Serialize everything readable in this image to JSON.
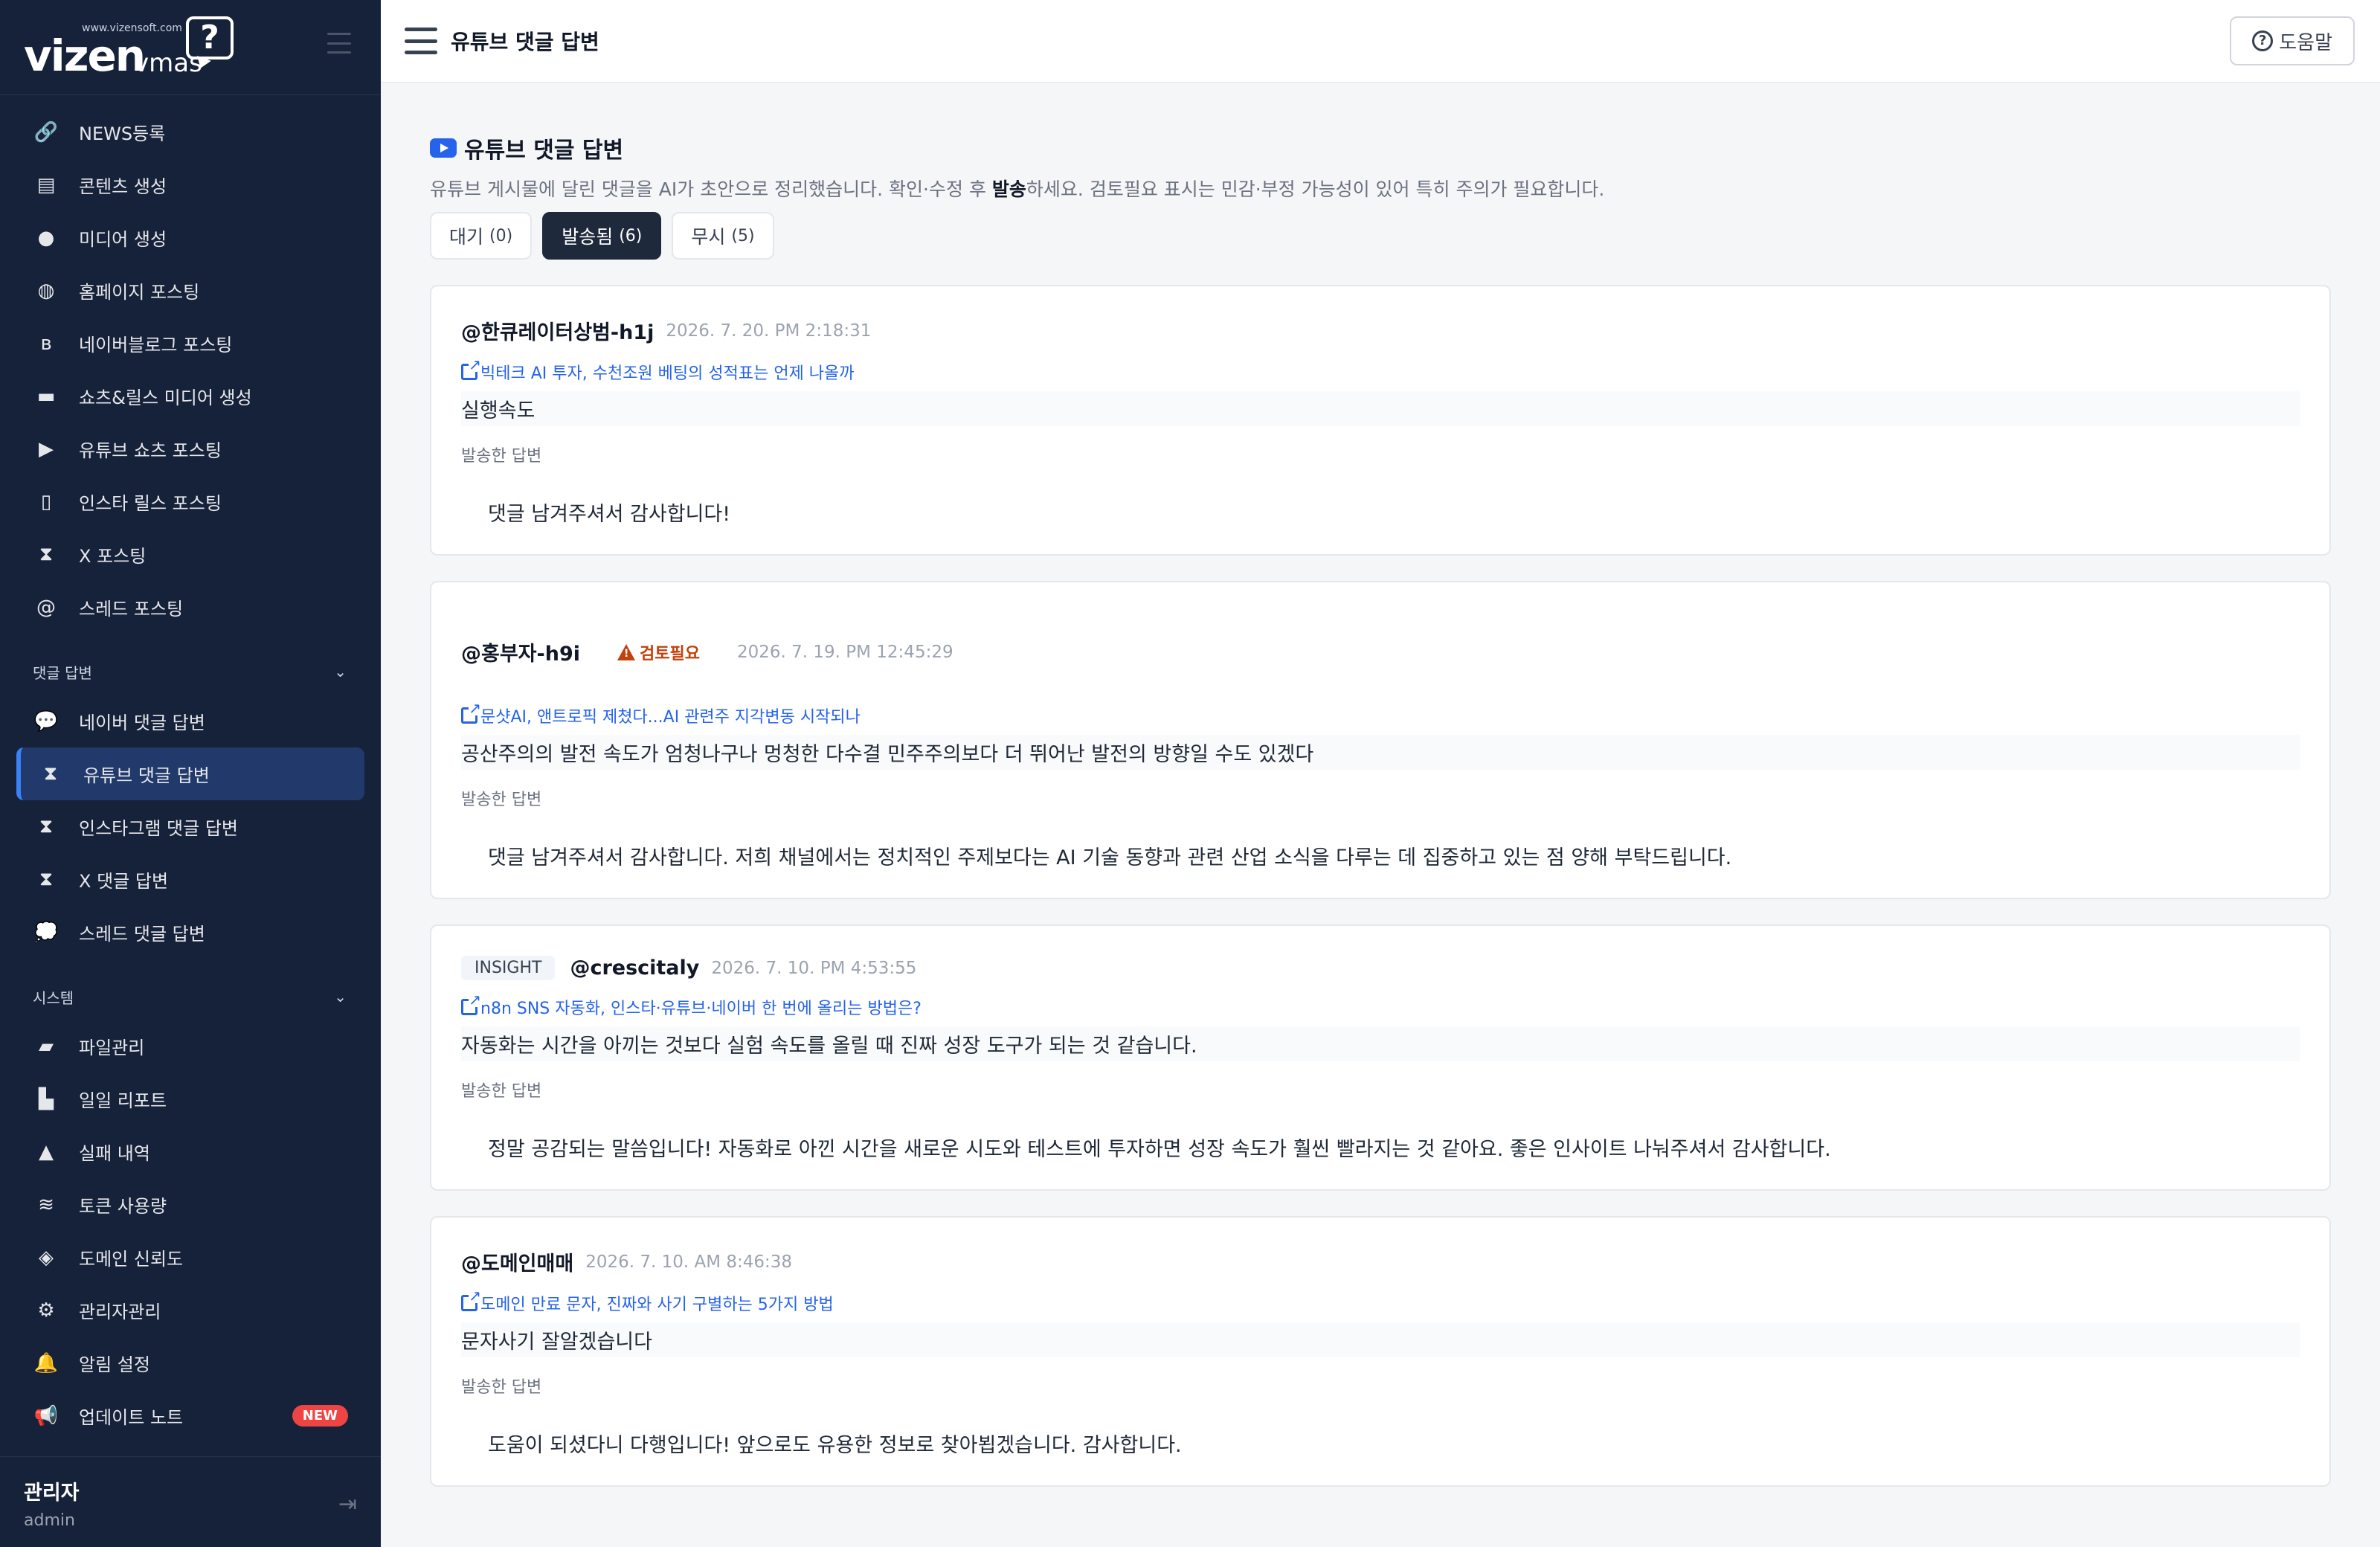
{
  "brand": {
    "logo_main": "vizen",
    "logo_sub": "vmas",
    "logo_url": "www.vizensoft.com",
    "logo_bubble": "?"
  },
  "nav": {
    "items": [
      {
        "label": "NEWS등록",
        "icon": "link-icon"
      },
      {
        "label": "콘텐츠 생성",
        "icon": "newspaper-icon"
      },
      {
        "label": "미디어 생성",
        "icon": "palette-icon"
      },
      {
        "label": "홈페이지 포스팅",
        "icon": "globe-icon"
      },
      {
        "label": "네이버블로그 포스팅",
        "icon": "blog-icon"
      },
      {
        "label": "쇼츠&릴스 미디어 생성",
        "icon": "clapperboard-icon"
      },
      {
        "label": "유튜브 쇼츠 포스팅",
        "icon": "play-icon"
      },
      {
        "label": "인스타 릴스 포스팅",
        "icon": "mobile-icon"
      },
      {
        "label": "X 포스팅",
        "icon": "hourglass-icon"
      },
      {
        "label": "스레드 포스팅",
        "icon": "at-icon"
      }
    ],
    "comment_section": "댓글 답변",
    "comment_items": [
      {
        "label": "네이버 댓글 답변",
        "icon": "comment-icon"
      },
      {
        "label": "유튜브 댓글 답변",
        "icon": "hourglass-icon"
      },
      {
        "label": "인스타그램 댓글 답변",
        "icon": "hourglass-icon"
      },
      {
        "label": "X 댓글 답변",
        "icon": "hourglass-icon"
      },
      {
        "label": "스레드 댓글 답변",
        "icon": "comments-icon"
      }
    ],
    "system_section": "시스템",
    "system_items": [
      {
        "label": "파일관리",
        "icon": "folder-icon"
      },
      {
        "label": "일일 리포트",
        "icon": "chart-icon"
      },
      {
        "label": "실패 내역",
        "icon": "warning-icon"
      },
      {
        "label": "토큰 사용량",
        "icon": "coins-icon"
      },
      {
        "label": "도메인 신뢰도",
        "icon": "shield-icon"
      },
      {
        "label": "관리자관리",
        "icon": "user-gear-icon"
      },
      {
        "label": "알림 설정",
        "icon": "bell-icon"
      },
      {
        "label": "업데이트 노트",
        "icon": "megaphone-icon"
      }
    ],
    "new_badge": "NEW"
  },
  "user": {
    "name": "관리자",
    "id": "admin"
  },
  "header": {
    "title": "유튜브 댓글 답변",
    "help": "도움말"
  },
  "page": {
    "title": "유튜브 댓글 답변",
    "desc_prefix": "유튜브 게시물에 달린 댓글을 AI가 초안으로 정리했습니다. 확인·수정 후 ",
    "desc_bold": "발송",
    "desc_suffix": "하세요. 검토필요 표시는 민감·부정 가능성이 있어 특히 주의가 필요합니다.",
    "filters": [
      {
        "label": "대기",
        "count": "(0)"
      },
      {
        "label": "발송됨",
        "count": "(6)"
      },
      {
        "label": "무시",
        "count": "(5)"
      }
    ],
    "reply_label": "발송한 답변"
  },
  "cards": [
    {
      "author": "@한큐레이터상범-h1j",
      "date": "2026. 7. 20. PM 2:18:31",
      "link": "빅테크 AI 투자, 수천조원 베팅의 성적표는 언제 나올까",
      "comment": "실행속도",
      "reply": "댓글 남겨주셔서 감사합니다!"
    },
    {
      "author": "@홍부자-h9i",
      "warn": "검토필요",
      "date": "2026. 7. 19. PM 12:45:29",
      "link": "문샷AI, 앤트로픽 제쳤다...AI 관련주 지각변동 시작되나",
      "comment": "공산주의의 발전 속도가 엄청나구나 멍청한 다수결 민주주의보다 더 뛰어난 발전의 방향일 수도 있겠다",
      "reply": "댓글 남겨주셔서 감사합니다. 저희 채널에서는 정치적인 주제보다는 AI 기술 동향과 관련 산업 소식을 다루는 데 집중하고 있는 점 양해 부탁드립니다."
    },
    {
      "tag": "INSIGHT",
      "author": "@crescitaly",
      "date": "2026. 7. 10. PM 4:53:55",
      "link": "n8n SNS 자동화, 인스타·유튜브·네이버 한 번에 올리는 방법은?",
      "comment": "자동화는 시간을 아끼는 것보다 실험 속도를 올릴 때 진짜 성장 도구가 되는 것 같습니다.",
      "reply": "정말 공감되는 말씀입니다! 자동화로 아낀 시간을 새로운 시도와 테스트에 투자하면 성장 속도가 훨씬 빨라지는 것 같아요. 좋은 인사이트 나눠주셔서 감사합니다."
    },
    {
      "author": "@도메인매매",
      "date": "2026. 7. 10. AM 8:46:38",
      "link": "도메인 만료 문자, 진짜와 사기 구별하는 5가지 방법",
      "comment": "문자사기 잘알겠습니다",
      "reply": "도움이 되셨다니 다행입니다! 앞으로도 유용한 정보로 찾아뵙겠습니다. 감사합니다."
    }
  ]
}
